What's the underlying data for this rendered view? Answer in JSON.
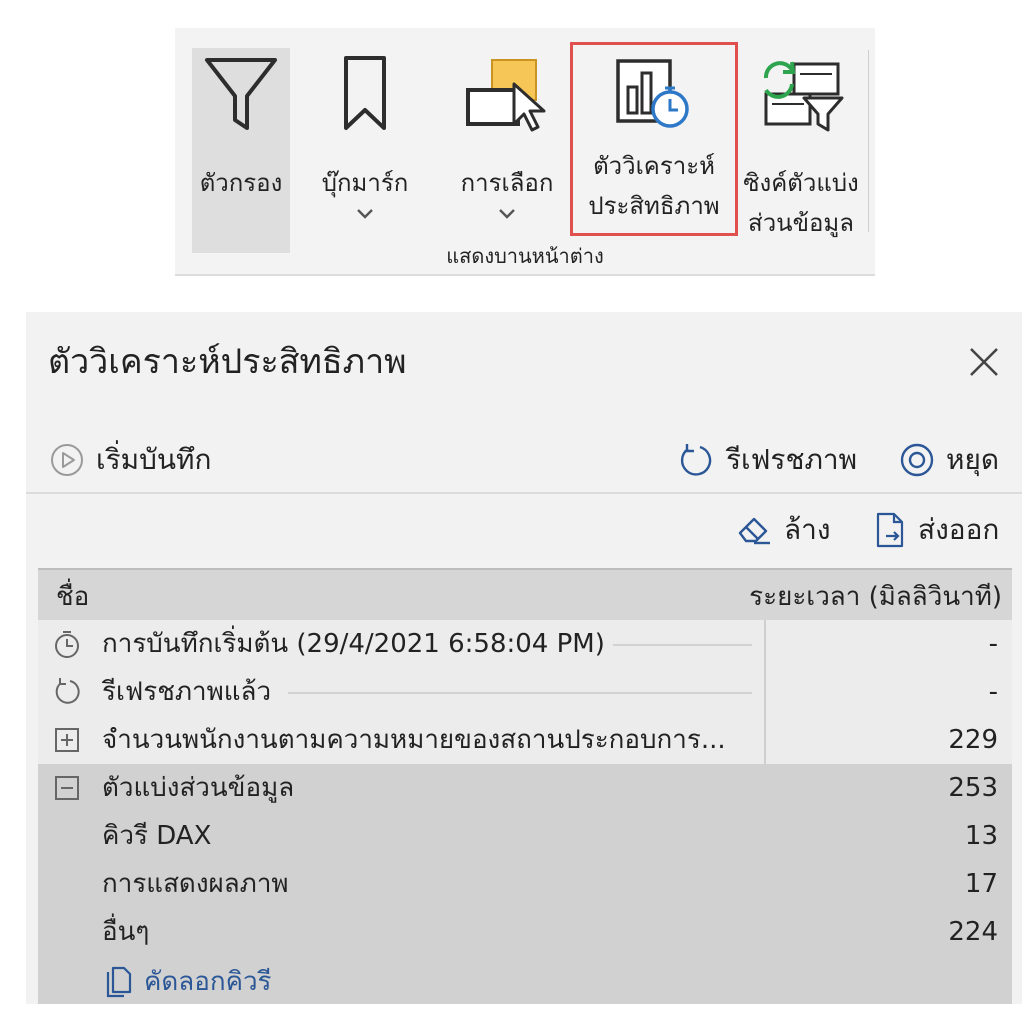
{
  "ribbon": {
    "buttons": [
      {
        "label": "ตัวกรอง",
        "icon": "filter-icon"
      },
      {
        "label": "บุ๊กมาร์ก",
        "icon": "bookmark-icon",
        "has_dropdown": true
      },
      {
        "label": "การเลือก",
        "icon": "selection-icon",
        "has_dropdown": true
      },
      {
        "label_line1": "ตัววิเคราะห์",
        "label_line2": "ประสิทธิภาพ",
        "icon": "performance-analyzer-icon"
      },
      {
        "label_line1": "ซิงค์ตัวแบ่ง",
        "label_line2": "ส่วนข้อมูล",
        "icon": "sync-slicers-icon"
      }
    ],
    "group_label": "แสดงบานหน้าต่าง",
    "highlight_color": "#e0504e"
  },
  "pane": {
    "title": "ตัววิเคราะห์ประสิทธิภาพ",
    "toolbar": {
      "start_label": "เริ่มบันทึก",
      "refresh_label": "รีเฟรชภาพ",
      "stop_label": "หยุด",
      "clear_label": "ล้าง",
      "export_label": "ส่งออก"
    },
    "table": {
      "col_name": "ชื่อ",
      "col_duration": "ระยะเวลา (มิลลิวินาที)",
      "rows": [
        {
          "icon": "stopwatch-icon",
          "name": "การบันทึกเริ่มต้น (29/4/2021 6:58:04 PM)",
          "duration": "-"
        },
        {
          "icon": "refresh-icon",
          "name": "รีเฟรชภาพแล้ว",
          "duration": "-"
        },
        {
          "icon": "expand-icon",
          "name": "จำนวนพนักงานตามความหมายของสถานประกอบการ...",
          "duration": "229"
        },
        {
          "icon": "collapse-icon",
          "name": "ตัวแบ่งส่วนข้อมูล",
          "duration": "253"
        },
        {
          "name": "คิวรี DAX",
          "duration": "13"
        },
        {
          "name": "การแสดงผลภาพ",
          "duration": "17"
        },
        {
          "name": "อื่นๆ",
          "duration": "224"
        }
      ],
      "copy_query_label": "คัดลอกคิวรี"
    },
    "link_color": "#2b5797"
  }
}
